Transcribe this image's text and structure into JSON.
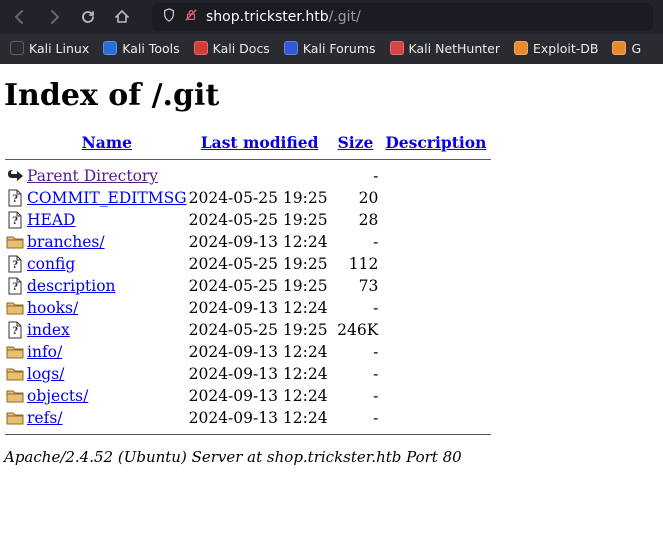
{
  "browser": {
    "url_host": "shop.trickster.htb",
    "url_path": "/.git/"
  },
  "bookmarks": [
    {
      "label": "Kali Linux",
      "color": "#2a2a31"
    },
    {
      "label": "Kali Tools",
      "color": "#2a6fd6"
    },
    {
      "label": "Kali Docs",
      "color": "#d43b3b"
    },
    {
      "label": "Kali Forums",
      "color": "#3357d6"
    },
    {
      "label": "Kali NetHunter",
      "color": "#d64545"
    },
    {
      "label": "Exploit-DB",
      "color": "#e88b2e"
    },
    {
      "label": "G",
      "color": "#e88b2e"
    }
  ],
  "heading": "Index of /.git",
  "columns": {
    "name": "Name",
    "last_modified": "Last modified",
    "size": "Size",
    "description": "Description"
  },
  "parent": {
    "label": "Parent Directory",
    "size": "-"
  },
  "rows": [
    {
      "type": "file",
      "name": "COMMIT_EDITMSG",
      "last_modified": "2024-05-25 19:25",
      "size": "20"
    },
    {
      "type": "file",
      "name": "HEAD",
      "last_modified": "2024-05-25 19:25",
      "size": "28"
    },
    {
      "type": "folder",
      "name": "branches/",
      "last_modified": "2024-09-13 12:24",
      "size": "-"
    },
    {
      "type": "file",
      "name": "config",
      "last_modified": "2024-05-25 19:25",
      "size": "112"
    },
    {
      "type": "file",
      "name": "description",
      "last_modified": "2024-05-25 19:25",
      "size": "73"
    },
    {
      "type": "folder",
      "name": "hooks/",
      "last_modified": "2024-09-13 12:24",
      "size": "-"
    },
    {
      "type": "file",
      "name": "index",
      "last_modified": "2024-05-25 19:25",
      "size": "246K"
    },
    {
      "type": "folder",
      "name": "info/",
      "last_modified": "2024-09-13 12:24",
      "size": "-"
    },
    {
      "type": "folder",
      "name": "logs/",
      "last_modified": "2024-09-13 12:24",
      "size": "-"
    },
    {
      "type": "folder",
      "name": "objects/",
      "last_modified": "2024-09-13 12:24",
      "size": "-"
    },
    {
      "type": "folder",
      "name": "refs/",
      "last_modified": "2024-09-13 12:24",
      "size": "-"
    }
  ],
  "footer": "Apache/2.4.52 (Ubuntu) Server at shop.trickster.htb Port 80"
}
